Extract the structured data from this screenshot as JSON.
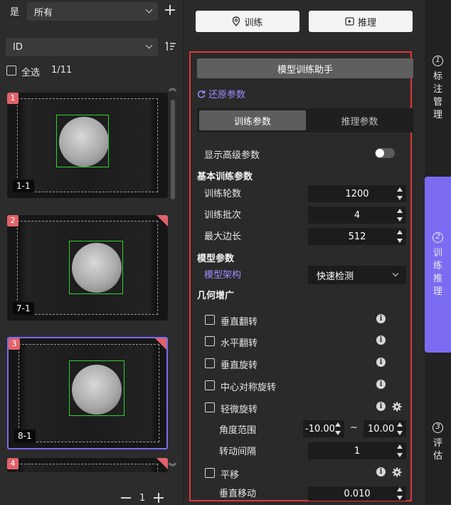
{
  "filter": {
    "label": "是",
    "value": "所有"
  },
  "sort": {
    "value": "ID"
  },
  "select_all": {
    "label": "全选",
    "count": "1/11"
  },
  "thumbnails": [
    {
      "index": "1",
      "label": "1-1"
    },
    {
      "index": "2",
      "label": "7-1"
    },
    {
      "index": "3",
      "label": "8-1"
    },
    {
      "index": "4",
      "label": ""
    }
  ],
  "pager": {
    "page": "1"
  },
  "top_tabs": {
    "train": "训练",
    "infer": "推理"
  },
  "panel": {
    "helper_title": "模型训练助手",
    "restore": "还原参数",
    "seg_train": "训练参数",
    "seg_infer": "推理参数",
    "show_advanced": "显示高级参数",
    "basic_section": "基本训练参数",
    "epochs_label": "训练轮数",
    "epochs": "1200",
    "batch_label": "训练批次",
    "batch": "4",
    "maxside_label": "最大边长",
    "maxside": "512",
    "model_section": "模型参数",
    "arch_label": "模型架构",
    "arch": "快速检测",
    "aug_section": "几何增广",
    "aug": [
      "垂直翻转",
      "水平翻转",
      "垂直旋转",
      "中心对称旋转",
      "轻微旋转"
    ],
    "angle_label": "角度范围",
    "angle_min": "-10.00",
    "tilde": "~",
    "angle_max": "10.00",
    "rot_step_label": "转动间隔",
    "rot_step": "1",
    "translate_label": "平移",
    "vshift_label": "垂直移动",
    "vshift": "0.010"
  },
  "side_tabs": [
    {
      "num": "1",
      "chars": [
        "标",
        "注",
        "管",
        "理"
      ]
    },
    {
      "num": "2",
      "chars": [
        "训",
        "练",
        "推",
        "理"
      ]
    },
    {
      "num": "3",
      "chars": [
        "评",
        "估"
      ]
    }
  ],
  "colors": {
    "accent": "#7b6cf2",
    "highlight_border": "#e23636",
    "tag": "#e2626a",
    "bbox": "#2bd42b"
  }
}
